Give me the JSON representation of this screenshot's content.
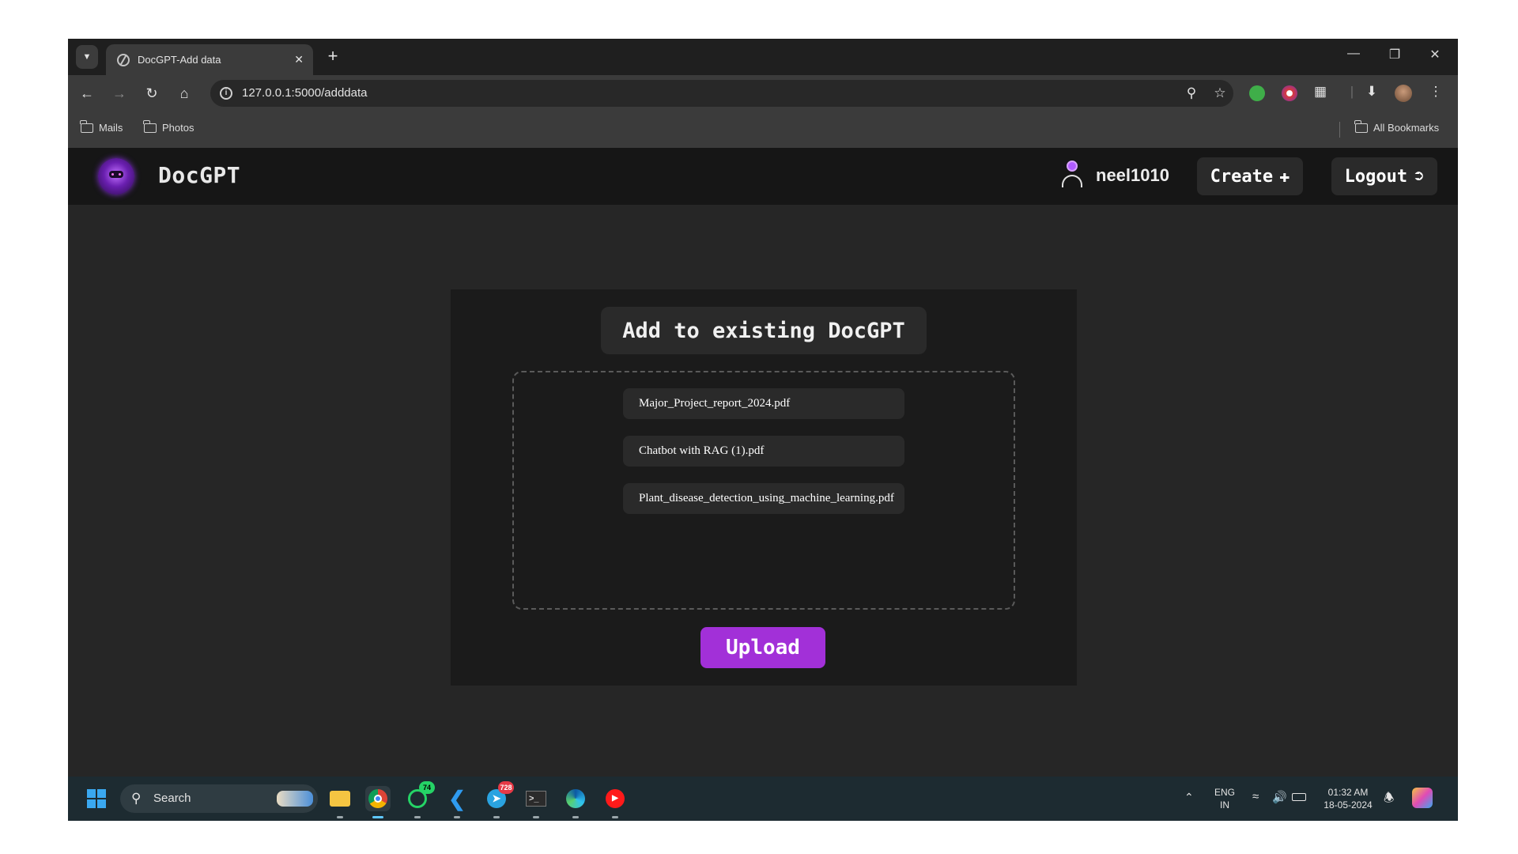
{
  "browser": {
    "tab_title": "DocGPT-Add data",
    "url": "127.0.0.1:5000/adddata",
    "bookmarks": [
      "Mails",
      "Photos"
    ],
    "all_bookmarks": "All Bookmarks"
  },
  "app": {
    "brand": "DocGPT",
    "username": "neel1010",
    "create_label": "Create",
    "logout_label": "Logout"
  },
  "card": {
    "title": "Add to existing DocGPT",
    "files": [
      "Major_Project_report_2024.pdf",
      "Chatbot with RAG (1).pdf",
      "Plant_disease_detection_using_machine_learning.pdf"
    ],
    "upload_label": "Upload"
  },
  "taskbar": {
    "search_label": "Search",
    "whatsapp_badge": "74",
    "telegram_badge": "728",
    "lang_top": "ENG",
    "lang_bottom": "IN",
    "time": "01:32 AM",
    "date": "18-05-2024"
  },
  "colors": {
    "accent": "#a230d8",
    "page_bg": "#262626",
    "header_bg": "#161616",
    "card_bg": "#1b1b1b"
  }
}
